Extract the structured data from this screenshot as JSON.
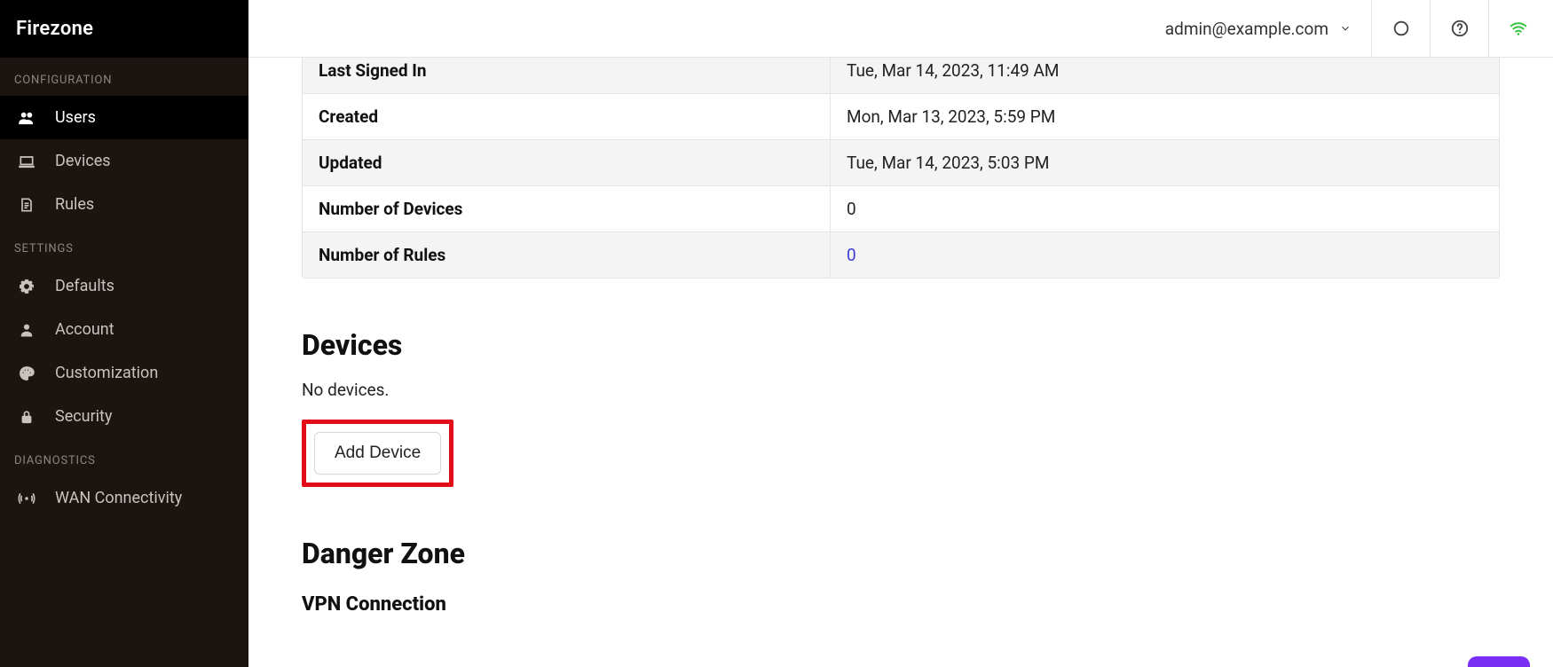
{
  "brand": "Firezone",
  "header": {
    "account_email": "admin@example.com"
  },
  "sidebar": {
    "groups": [
      {
        "label": "CONFIGURATION",
        "items": [
          {
            "icon": "users-icon",
            "label": "Users",
            "active": true
          },
          {
            "icon": "laptop-icon",
            "label": "Devices",
            "active": false
          },
          {
            "icon": "rules-icon",
            "label": "Rules",
            "active": false
          }
        ]
      },
      {
        "label": "SETTINGS",
        "items": [
          {
            "icon": "gear-icon",
            "label": "Defaults",
            "active": false
          },
          {
            "icon": "person-icon",
            "label": "Account",
            "active": false
          },
          {
            "icon": "palette-icon",
            "label": "Customization",
            "active": false
          },
          {
            "icon": "lock-icon",
            "label": "Security",
            "active": false
          }
        ]
      },
      {
        "label": "DIAGNOSTICS",
        "items": [
          {
            "icon": "signal-icon",
            "label": "WAN Connectivity",
            "active": false
          }
        ]
      }
    ]
  },
  "details": {
    "rows": [
      {
        "k": "Last Signed In",
        "v": "Tue, Mar 14, 2023, 11:49 AM",
        "link": false
      },
      {
        "k": "Created",
        "v": "Mon, Mar 13, 2023, 5:59 PM",
        "link": false
      },
      {
        "k": "Updated",
        "v": "Tue, Mar 14, 2023, 5:03 PM",
        "link": false
      },
      {
        "k": "Number of Devices",
        "v": "0",
        "link": false
      },
      {
        "k": "Number of Rules",
        "v": "0",
        "link": true
      }
    ]
  },
  "devices": {
    "heading": "Devices",
    "empty_text": "No devices.",
    "add_label": "Add Device"
  },
  "danger": {
    "heading": "Danger Zone",
    "sub_heading": "VPN Connection"
  }
}
